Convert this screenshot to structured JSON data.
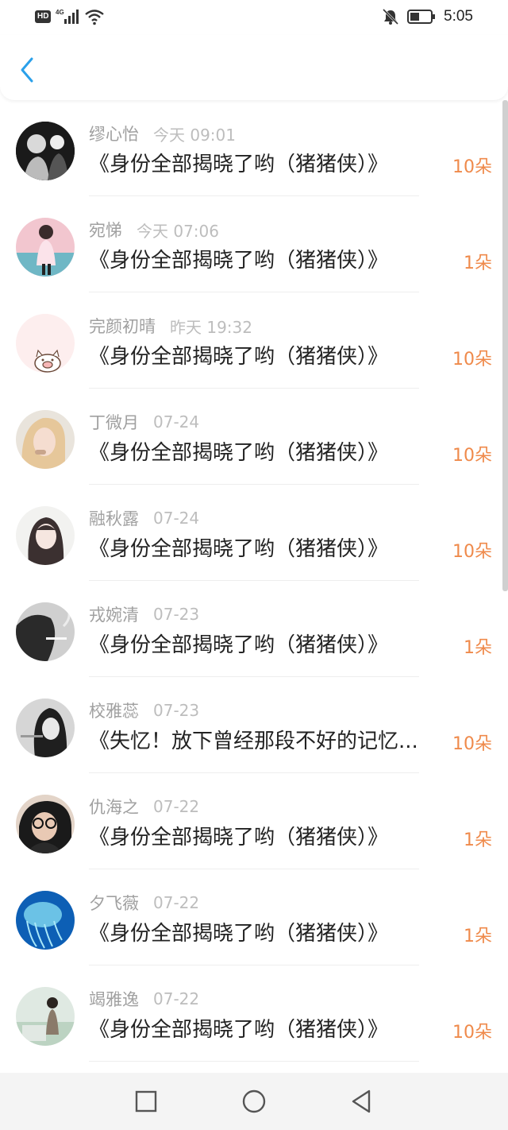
{
  "status_bar": {
    "hd": "HD",
    "network": "4G",
    "time": "5:05",
    "icons": [
      "signal-icon",
      "wifi-icon",
      "mute-bell-icon",
      "battery-icon"
    ]
  },
  "header": {
    "back_icon": "chevron-left-icon",
    "accent_color": "#2aa0ea"
  },
  "list": {
    "count_color": "#ef8a4b",
    "items": [
      {
        "name": "缪心怡",
        "time": "今天 09:01",
        "title": "《身份全部揭晓了哟（猪猪侠）》",
        "count": "10朵"
      },
      {
        "name": "宛悌",
        "time": "今天 07:06",
        "title": "《身份全部揭晓了哟（猪猪侠）》",
        "count": "1朵"
      },
      {
        "name": "完颜初晴",
        "time": "昨天 19:32",
        "title": "《身份全部揭晓了哟（猪猪侠）》",
        "count": "10朵"
      },
      {
        "name": "丁微月",
        "time": "07-24",
        "title": "《身份全部揭晓了哟（猪猪侠）》",
        "count": "10朵"
      },
      {
        "name": "融秋露",
        "time": "07-24",
        "title": "《身份全部揭晓了哟（猪猪侠）》",
        "count": "10朵"
      },
      {
        "name": "戎婉清",
        "time": "07-23",
        "title": "《身份全部揭晓了哟（猪猪侠）》",
        "count": "1朵"
      },
      {
        "name": "校雅蕊",
        "time": "07-23",
        "title": "《失忆！放下曾经那段不好的记忆...",
        "count": "10朵"
      },
      {
        "name": "仇海之",
        "time": "07-22",
        "title": "《身份全部揭晓了哟（猪猪侠）》",
        "count": "1朵"
      },
      {
        "name": "夕飞薇",
        "time": "07-22",
        "title": "《身份全部揭晓了哟（猪猪侠）》",
        "count": "1朵"
      },
      {
        "name": "竭雅逸",
        "time": "07-22",
        "title": "《身份全部揭晓了哟（猪猪侠）》",
        "count": "10朵"
      }
    ]
  },
  "nav_bar": {
    "icons": [
      "square-recent-icon",
      "circle-home-icon",
      "triangle-back-icon"
    ]
  }
}
